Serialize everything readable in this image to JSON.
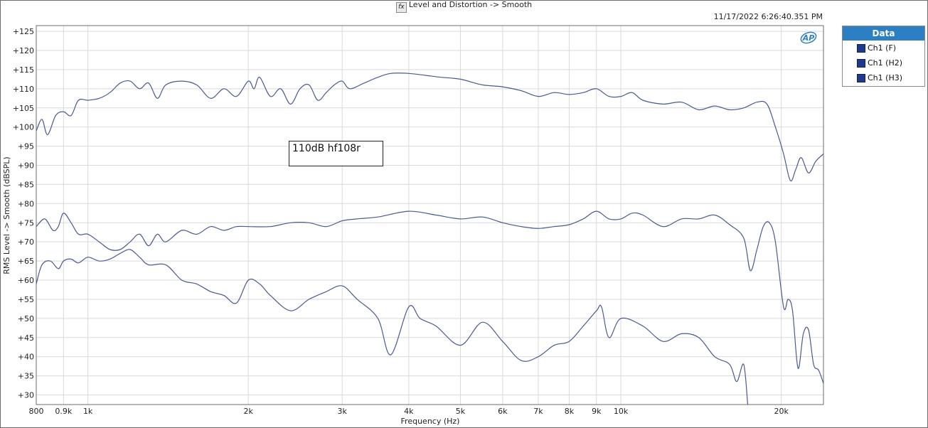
{
  "window": {
    "title": "Level and Distortion -> Smooth",
    "timestamp": "11/17/2022 6:26:40.351 PM"
  },
  "legend": {
    "header": "Data",
    "items": [
      "Ch1 (F)",
      "Ch1 (H2)",
      "Ch1 (H3)"
    ]
  },
  "annotation": "110dB hf108r",
  "colors": {
    "trace": "#4a5a90",
    "grid": "#d9d9d9",
    "axis": "#6d6d6d",
    "legend_header": "#2d7fc3"
  },
  "chart_data": {
    "type": "line",
    "xlabel": "Frequency (Hz)",
    "ylabel": "RMS Level -> Smooth (dBSPL)",
    "x_scale": "log",
    "xlim": [
      800,
      24000
    ],
    "ylim": [
      27.5,
      126.5
    ],
    "grid": true,
    "legend_position": "outside-right",
    "x_ticks": [
      {
        "value": 800,
        "label": "800"
      },
      {
        "value": 900,
        "label": "0.9k"
      },
      {
        "value": 1000,
        "label": "1k"
      },
      {
        "value": 2000,
        "label": "2k"
      },
      {
        "value": 3000,
        "label": "3k"
      },
      {
        "value": 4000,
        "label": "4k"
      },
      {
        "value": 5000,
        "label": "5k"
      },
      {
        "value": 6000,
        "label": "6k"
      },
      {
        "value": 7000,
        "label": "7k"
      },
      {
        "value": 8000,
        "label": "8k"
      },
      {
        "value": 9000,
        "label": "9k"
      },
      {
        "value": 10000,
        "label": "10k"
      },
      {
        "value": 20000,
        "label": "20k"
      }
    ],
    "y_ticks": [
      {
        "value": 125,
        "label": "+125"
      },
      {
        "value": 120,
        "label": "+120"
      },
      {
        "value": 115,
        "label": "+115"
      },
      {
        "value": 110,
        "label": "+110"
      },
      {
        "value": 105,
        "label": "+105"
      },
      {
        "value": 100,
        "label": "+100"
      },
      {
        "value": 95,
        "label": "+95"
      },
      {
        "value": 90,
        "label": "+90"
      },
      {
        "value": 85,
        "label": "+85"
      },
      {
        "value": 80,
        "label": "+80"
      },
      {
        "value": 75,
        "label": "+75"
      },
      {
        "value": 70,
        "label": "+70"
      },
      {
        "value": 65,
        "label": "+65"
      },
      {
        "value": 60,
        "label": "+60"
      },
      {
        "value": 55,
        "label": "+55"
      },
      {
        "value": 50,
        "label": "+50"
      },
      {
        "value": 45,
        "label": "+45"
      },
      {
        "value": 40,
        "label": "+40"
      },
      {
        "value": 35,
        "label": "+35"
      },
      {
        "value": 30,
        "label": "+30"
      }
    ],
    "series": [
      {
        "name": "Ch1 (F)",
        "points": [
          [
            800,
            99
          ],
          [
            820,
            102
          ],
          [
            840,
            98
          ],
          [
            870,
            103
          ],
          [
            900,
            104
          ],
          [
            930,
            103
          ],
          [
            960,
            107
          ],
          [
            1000,
            107
          ],
          [
            1050,
            107.5
          ],
          [
            1100,
            109
          ],
          [
            1150,
            111.5
          ],
          [
            1200,
            112
          ],
          [
            1250,
            110
          ],
          [
            1300,
            111.5
          ],
          [
            1350,
            107.5
          ],
          [
            1400,
            111
          ],
          [
            1500,
            112
          ],
          [
            1600,
            111
          ],
          [
            1700,
            107.5
          ],
          [
            1800,
            110
          ],
          [
            1900,
            108
          ],
          [
            2000,
            112
          ],
          [
            2050,
            110
          ],
          [
            2100,
            113
          ],
          [
            2200,
            108
          ],
          [
            2300,
            110
          ],
          [
            2400,
            106
          ],
          [
            2500,
            110
          ],
          [
            2600,
            111
          ],
          [
            2700,
            107
          ],
          [
            2800,
            109
          ],
          [
            2900,
            111
          ],
          [
            3000,
            112
          ],
          [
            3100,
            110
          ],
          [
            3300,
            111.5
          ],
          [
            3500,
            113
          ],
          [
            3700,
            114
          ],
          [
            4000,
            114
          ],
          [
            4300,
            113.5
          ],
          [
            4600,
            113
          ],
          [
            5000,
            112.5
          ],
          [
            5500,
            111
          ],
          [
            6000,
            110.5
          ],
          [
            6500,
            109.5
          ],
          [
            7000,
            108
          ],
          [
            7500,
            109
          ],
          [
            8000,
            108.5
          ],
          [
            8500,
            109
          ],
          [
            9000,
            110
          ],
          [
            9500,
            108
          ],
          [
            10000,
            108
          ],
          [
            10500,
            109
          ],
          [
            11000,
            107
          ],
          [
            12000,
            106
          ],
          [
            13000,
            106.5
          ],
          [
            14000,
            104.5
          ],
          [
            15000,
            105.5
          ],
          [
            16000,
            104.5
          ],
          [
            17000,
            105
          ],
          [
            18000,
            106.5
          ],
          [
            18800,
            106
          ],
          [
            19500,
            100
          ],
          [
            20200,
            93
          ],
          [
            20800,
            86
          ],
          [
            21300,
            89
          ],
          [
            21800,
            92
          ],
          [
            22500,
            88
          ],
          [
            23200,
            91
          ],
          [
            24000,
            93
          ]
        ]
      },
      {
        "name": "Ch1 (H2)",
        "points": [
          [
            800,
            74
          ],
          [
            830,
            76
          ],
          [
            860,
            73
          ],
          [
            880,
            74
          ],
          [
            900,
            77.5
          ],
          [
            930,
            75
          ],
          [
            960,
            72
          ],
          [
            1000,
            72
          ],
          [
            1050,
            70
          ],
          [
            1100,
            68
          ],
          [
            1150,
            68
          ],
          [
            1200,
            70
          ],
          [
            1250,
            72
          ],
          [
            1300,
            69
          ],
          [
            1350,
            72
          ],
          [
            1400,
            70
          ],
          [
            1500,
            73
          ],
          [
            1600,
            72
          ],
          [
            1700,
            74
          ],
          [
            1800,
            73
          ],
          [
            1900,
            74
          ],
          [
            2000,
            74
          ],
          [
            2200,
            74
          ],
          [
            2400,
            75
          ],
          [
            2600,
            75
          ],
          [
            2800,
            74
          ],
          [
            3000,
            75.5
          ],
          [
            3200,
            76
          ],
          [
            3500,
            76.5
          ],
          [
            4000,
            78
          ],
          [
            4500,
            77
          ],
          [
            5000,
            76
          ],
          [
            5500,
            76.5
          ],
          [
            6000,
            75
          ],
          [
            6500,
            74
          ],
          [
            7000,
            73.5
          ],
          [
            7500,
            74
          ],
          [
            8000,
            74.5
          ],
          [
            8500,
            76
          ],
          [
            9000,
            78
          ],
          [
            9500,
            76
          ],
          [
            10000,
            76
          ],
          [
            10500,
            77.5
          ],
          [
            11000,
            77
          ],
          [
            12000,
            74
          ],
          [
            13000,
            76
          ],
          [
            14000,
            76
          ],
          [
            15000,
            77
          ],
          [
            16000,
            74.5
          ],
          [
            17000,
            71
          ],
          [
            17500,
            62.5
          ],
          [
            18000,
            68
          ],
          [
            18500,
            74
          ],
          [
            19000,
            75
          ],
          [
            19500,
            70
          ],
          [
            20200,
            53
          ],
          [
            20600,
            55
          ],
          [
            21000,
            52
          ],
          [
            21500,
            37
          ],
          [
            22000,
            46
          ],
          [
            22500,
            47
          ],
          [
            23000,
            38
          ],
          [
            23500,
            36.5
          ],
          [
            24000,
            33
          ]
        ]
      },
      {
        "name": "Ch1 (H3)",
        "points": [
          [
            800,
            59
          ],
          [
            820,
            64
          ],
          [
            850,
            65
          ],
          [
            880,
            63
          ],
          [
            900,
            65
          ],
          [
            930,
            65.5
          ],
          [
            960,
            64.5
          ],
          [
            1000,
            66
          ],
          [
            1050,
            65
          ],
          [
            1100,
            65.5
          ],
          [
            1150,
            67
          ],
          [
            1200,
            68
          ],
          [
            1250,
            66
          ],
          [
            1300,
            64
          ],
          [
            1400,
            64
          ],
          [
            1500,
            60
          ],
          [
            1600,
            59
          ],
          [
            1700,
            57
          ],
          [
            1800,
            56
          ],
          [
            1900,
            54
          ],
          [
            2000,
            60
          ],
          [
            2100,
            59
          ],
          [
            2200,
            56
          ],
          [
            2400,
            52
          ],
          [
            2600,
            55
          ],
          [
            2800,
            57
          ],
          [
            3000,
            58.5
          ],
          [
            3200,
            55
          ],
          [
            3500,
            50
          ],
          [
            3700,
            40.5
          ],
          [
            4000,
            53
          ],
          [
            4200,
            50
          ],
          [
            4500,
            48
          ],
          [
            5000,
            43
          ],
          [
            5500,
            49
          ],
          [
            6000,
            44
          ],
          [
            6500,
            39
          ],
          [
            7000,
            40
          ],
          [
            7500,
            43
          ],
          [
            8000,
            44
          ],
          [
            8500,
            48
          ],
          [
            9000,
            52
          ],
          [
            9200,
            53
          ],
          [
            9500,
            45
          ],
          [
            10000,
            50
          ],
          [
            11000,
            48
          ],
          [
            12000,
            44
          ],
          [
            13000,
            46
          ],
          [
            14000,
            45
          ],
          [
            15000,
            40
          ],
          [
            16000,
            38
          ],
          [
            16500,
            33.5
          ],
          [
            17000,
            38
          ],
          [
            17300,
            27.5
          ]
        ]
      }
    ]
  }
}
